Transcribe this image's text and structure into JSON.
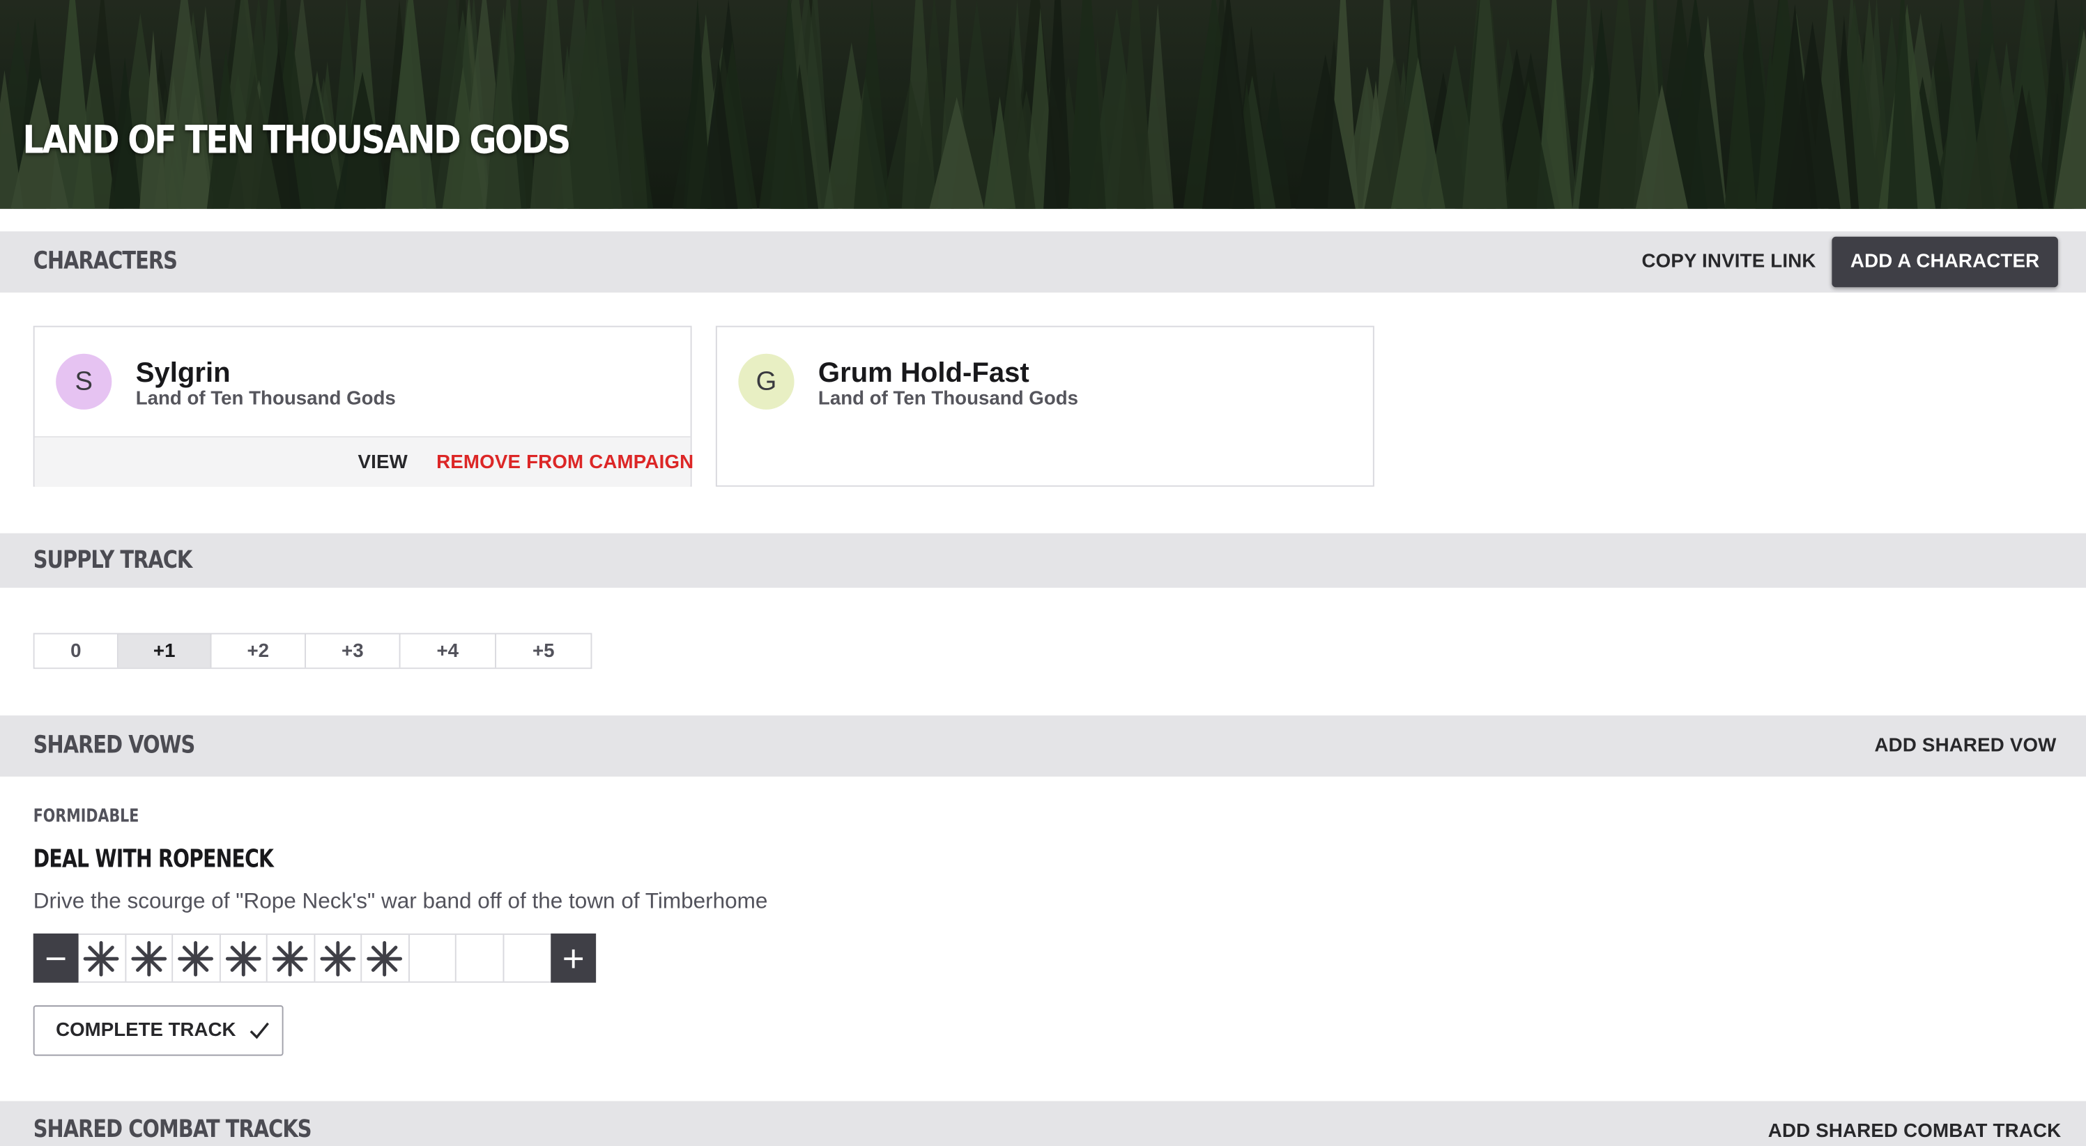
{
  "campaign": {
    "title": "LAND OF TEN THOUSAND GODS"
  },
  "characters_section": {
    "title": "CHARACTERS",
    "copy_invite_label": "COPY INVITE LINK",
    "add_character_label": "ADD A CHARACTER",
    "characters": [
      {
        "initial": "S",
        "name": "Sylgrin",
        "campaign": "Land of Ten Thousand Gods",
        "avatar_color": "#e6c3f2",
        "actions": {
          "view": "VIEW",
          "remove": "REMOVE FROM CAMPAIGN"
        }
      },
      {
        "initial": "G",
        "name": "Grum Hold-Fast",
        "campaign": "Land of Ten Thousand Gods",
        "avatar_color": "#e8efc3"
      }
    ]
  },
  "supply_section": {
    "title": "SUPPLY TRACK",
    "options": [
      "0",
      "+1",
      "+2",
      "+3",
      "+4",
      "+5"
    ],
    "selected": "+1"
  },
  "vows_section": {
    "title": "SHARED VOWS",
    "add_label": "ADD SHARED VOW",
    "vows": [
      {
        "rank": "FORMIDABLE",
        "title": "DEAL WITH ROPENECK",
        "description": "Drive the scourge of \"Rope Neck's\" war band off of the town of Timberhome",
        "progress_boxes_filled": 7,
        "progress_boxes_total": 10,
        "decrement_label": "−",
        "increment_label": "+",
        "complete_label": "COMPLETE TRACK"
      }
    ]
  },
  "combat_section": {
    "title": "SHARED COMBAT TRACKS",
    "add_label": "ADD SHARED COMBAT TRACK"
  },
  "colors": {
    "accent_dark": "#3f3f46",
    "danger": "#dc2626",
    "section_bg": "#e4e4e7"
  }
}
